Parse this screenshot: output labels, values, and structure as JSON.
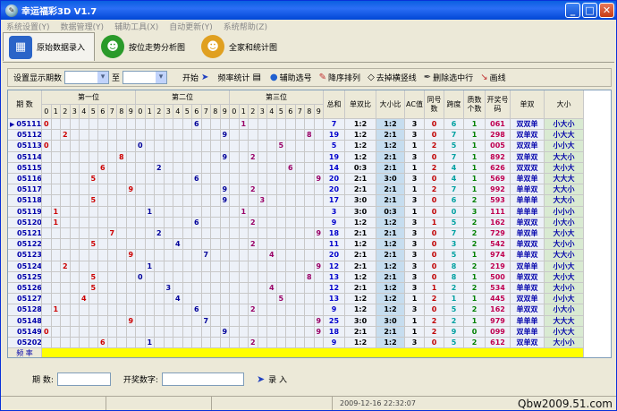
{
  "window": {
    "title": "幸运福彩3D V1.7"
  },
  "menu": [
    "系统设置(Y)",
    "数据管理(Y)",
    "辅助工具(X)",
    "自动更新(Y)",
    "系统帮助(Z)"
  ],
  "tabs": [
    {
      "label": "原始数据录入",
      "active": true
    },
    {
      "label": "按位走势分析图",
      "active": false
    },
    {
      "label": "全家和统计图",
      "active": false
    }
  ],
  "toolbar": {
    "period_label": "设置显示期数",
    "to_label": "至",
    "start": "开始",
    "freq": "频率统计",
    "aux": "辅助选号",
    "desc": "降序排列",
    "hide_h": "去掉横竖线",
    "delete": "删除选中行",
    "draw": "画线"
  },
  "grid": {
    "h_period": "期 数",
    "h_pos1": "第一位",
    "h_pos2": "第二位",
    "h_pos3": "第三位",
    "h_sum": "总和",
    "h_oe": "单双比",
    "h_bs": "大小比",
    "h_ac": "AC值",
    "h_same": "同号数",
    "h_span": "跨度",
    "h_prime": "质数个数",
    "h_num": "开奖号码",
    "h_sd": "单双",
    "h_dx": "大小",
    "digits": [
      "0",
      "1",
      "2",
      "3",
      "4",
      "5",
      "6",
      "7",
      "8",
      "9"
    ],
    "freq_label": "频 率",
    "rows": [
      {
        "p": "05111",
        "n": [
          0,
          6,
          1
        ],
        "sum": "7",
        "oe": "1:2",
        "bs": "1:2",
        "ac": "3",
        "same": "0",
        "span": "6",
        "prime": "1",
        "num": "061",
        "sd": "双双单",
        "dx": "小大小"
      },
      {
        "p": "05112",
        "n": [
          2,
          9,
          8
        ],
        "sum": "19",
        "oe": "1:2",
        "bs": "2:1",
        "ac": "3",
        "same": "0",
        "span": "7",
        "prime": "1",
        "num": "298",
        "sd": "双单双",
        "dx": "小大大"
      },
      {
        "p": "05113",
        "n": [
          0,
          0,
          5
        ],
        "sum": "5",
        "oe": "1:2",
        "bs": "1:2",
        "ac": "1",
        "same": "2",
        "span": "5",
        "prime": "1",
        "num": "005",
        "sd": "双双单",
        "dx": "小小大"
      },
      {
        "p": "05114",
        "n": [
          8,
          9,
          2
        ],
        "sum": "19",
        "oe": "1:2",
        "bs": "2:1",
        "ac": "3",
        "same": "0",
        "span": "7",
        "prime": "1",
        "num": "892",
        "sd": "双单双",
        "dx": "大大小"
      },
      {
        "p": "05115",
        "n": [
          6,
          2,
          6
        ],
        "sum": "14",
        "oe": "0:3",
        "bs": "2:1",
        "ac": "1",
        "same": "2",
        "span": "4",
        "prime": "1",
        "num": "626",
        "sd": "双双双",
        "dx": "大小大"
      },
      {
        "p": "05116",
        "n": [
          5,
          6,
          9
        ],
        "sum": "20",
        "oe": "2:1",
        "bs": "3:0",
        "ac": "3",
        "same": "0",
        "span": "4",
        "prime": "1",
        "num": "569",
        "sd": "单双单",
        "dx": "大大大"
      },
      {
        "p": "05117",
        "n": [
          9,
          9,
          2
        ],
        "sum": "20",
        "oe": "2:1",
        "bs": "2:1",
        "ac": "1",
        "same": "2",
        "span": "7",
        "prime": "1",
        "num": "992",
        "sd": "单单双",
        "dx": "大大小"
      },
      {
        "p": "05118",
        "n": [
          5,
          9,
          3
        ],
        "sum": "17",
        "oe": "3:0",
        "bs": "2:1",
        "ac": "3",
        "same": "0",
        "span": "6",
        "prime": "2",
        "num": "593",
        "sd": "单单单",
        "dx": "大大小"
      },
      {
        "p": "05119",
        "n": [
          1,
          1,
          1
        ],
        "sum": "3",
        "oe": "3:0",
        "bs": "0:3",
        "ac": "1",
        "same": "0",
        "span": "0",
        "prime": "3",
        "num": "111",
        "sd": "单单单",
        "dx": "小小小"
      },
      {
        "p": "05120",
        "n": [
          1,
          6,
          2
        ],
        "sum": "9",
        "oe": "1:2",
        "bs": "1:2",
        "ac": "3",
        "same": "1",
        "span": "5",
        "prime": "2",
        "num": "162",
        "sd": "单双双",
        "dx": "小大小"
      },
      {
        "p": "05121",
        "n": [
          7,
          2,
          9
        ],
        "sum": "18",
        "oe": "2:1",
        "bs": "2:1",
        "ac": "3",
        "same": "0",
        "span": "7",
        "prime": "2",
        "num": "729",
        "sd": "单双单",
        "dx": "大小大"
      },
      {
        "p": "05122",
        "n": [
          5,
          4,
          2
        ],
        "sum": "11",
        "oe": "1:2",
        "bs": "1:2",
        "ac": "3",
        "same": "0",
        "span": "3",
        "prime": "2",
        "num": "542",
        "sd": "单双双",
        "dx": "大小小"
      },
      {
        "p": "05123",
        "n": [
          9,
          7,
          4
        ],
        "sum": "20",
        "oe": "2:1",
        "bs": "2:1",
        "ac": "3",
        "same": "0",
        "span": "5",
        "prime": "1",
        "num": "974",
        "sd": "单单双",
        "dx": "大大小"
      },
      {
        "p": "05124",
        "n": [
          2,
          1,
          9
        ],
        "sum": "12",
        "oe": "2:1",
        "bs": "1:2",
        "ac": "3",
        "same": "0",
        "span": "8",
        "prime": "2",
        "num": "219",
        "sd": "双单单",
        "dx": "小小大"
      },
      {
        "p": "05125",
        "n": [
          5,
          0,
          8
        ],
        "sum": "13",
        "oe": "1:2",
        "bs": "2:1",
        "ac": "3",
        "same": "0",
        "span": "8",
        "prime": "1",
        "num": "500",
        "sd": "单双双",
        "dx": "大小大"
      },
      {
        "p": "05126",
        "n": [
          5,
          3,
          4
        ],
        "sum": "12",
        "oe": "2:1",
        "bs": "1:2",
        "ac": "3",
        "same": "1",
        "span": "2",
        "prime": "2",
        "num": "534",
        "sd": "单单双",
        "dx": "大小小"
      },
      {
        "p": "05127",
        "n": [
          4,
          4,
          5
        ],
        "sum": "13",
        "oe": "1:2",
        "bs": "1:2",
        "ac": "1",
        "same": "2",
        "span": "1",
        "prime": "1",
        "num": "445",
        "sd": "双双单",
        "dx": "小小大"
      },
      {
        "p": "05128",
        "n": [
          1,
          6,
          2
        ],
        "sum": "9",
        "oe": "1:2",
        "bs": "1:2",
        "ac": "3",
        "same": "0",
        "span": "5",
        "prime": "2",
        "num": "162",
        "sd": "单双双",
        "dx": "小大小"
      },
      {
        "p": "05148",
        "n": [
          9,
          7,
          9
        ],
        "sum": "25",
        "oe": "3:0",
        "bs": "3:0",
        "ac": "1",
        "same": "2",
        "span": "2",
        "prime": "1",
        "num": "979",
        "sd": "单单单",
        "dx": "大大大"
      },
      {
        "p": "05149",
        "n": [
          0,
          9,
          9
        ],
        "sum": "18",
        "oe": "2:1",
        "bs": "2:1",
        "ac": "1",
        "same": "2",
        "span": "9",
        "prime": "0",
        "num": "099",
        "sd": "双单单",
        "dx": "小大大"
      },
      {
        "p": "05202",
        "n": [
          6,
          1,
          2
        ],
        "sum": "9",
        "oe": "1:2",
        "bs": "1:2",
        "ac": "3",
        "same": "0",
        "span": "5",
        "prime": "2",
        "num": "612",
        "sd": "双单双",
        "dx": "大小小"
      }
    ]
  },
  "bottom": {
    "period": "期  数:",
    "numbers": "开奖数字:",
    "enter": "录  入"
  },
  "status": {
    "datetime": "2009-12-16  22:32:07",
    "brand": "Qbw2009.51.com"
  },
  "colors": {
    "pos1": "#cc0000",
    "pos2": "#000099",
    "pos3": "#990066",
    "grid_bg": "#edf1f8"
  }
}
